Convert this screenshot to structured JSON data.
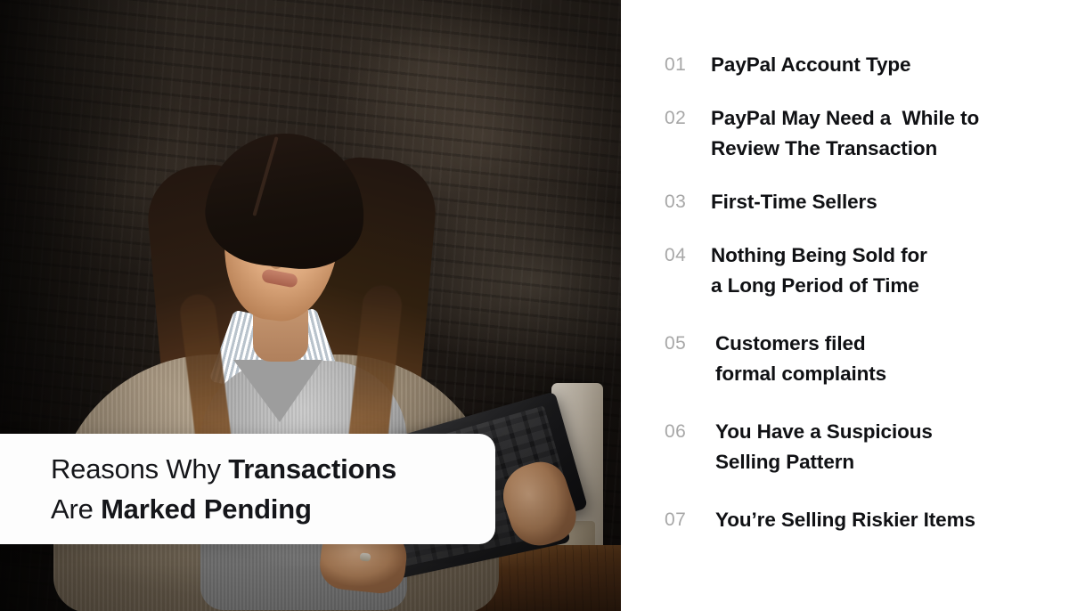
{
  "title_card": {
    "line1_prefix": "Reasons Why ",
    "line1_bold": "Transactions",
    "line2_prefix": "Are ",
    "line2_bold": "Marked Pending"
  },
  "photo": {
    "alt": "Woman in beige cardigan and gray sweater working on a tablet at a wooden desk against a dark textured wall"
  },
  "colors": {
    "number": "#a7a7a7",
    "text": "#101114",
    "panel_background": "#ffffff",
    "card_background": "#fdfdfd"
  },
  "reasons": [
    {
      "number": "01",
      "text": "PayPal Account Type"
    },
    {
      "number": "02",
      "text": "PayPal May Need a  While to\nReview The Transaction"
    },
    {
      "number": "03",
      "text": "First-Time Sellers"
    },
    {
      "number": "04",
      "text": "Nothing Being Sold for\na Long Period of Time"
    },
    {
      "number": "05",
      "text": "Customers filed\nformal complaints"
    },
    {
      "number": "06",
      "text": "You Have a Suspicious\nSelling Pattern"
    },
    {
      "number": "07",
      "text": "You’re Selling Riskier Items"
    }
  ]
}
